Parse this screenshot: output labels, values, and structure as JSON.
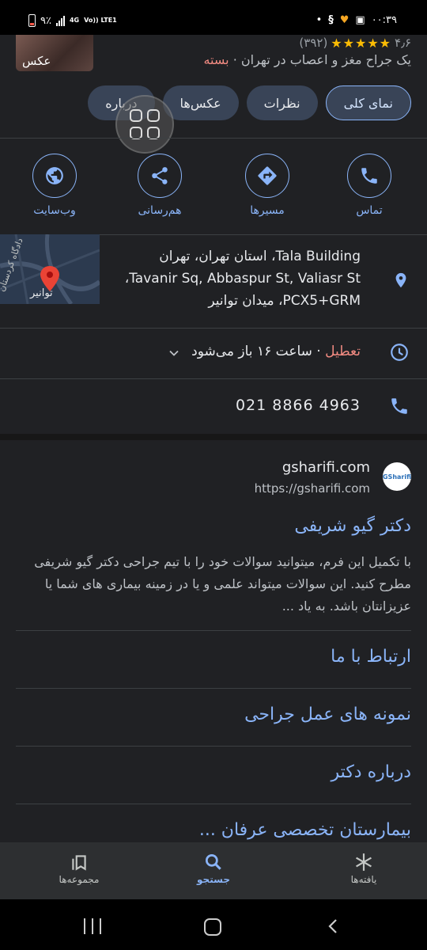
{
  "status_bar": {
    "time": "۰۰:۳۹",
    "battery": "۹٪",
    "network": "4G",
    "volte": "Vo)) LTE1",
    "dot": "•"
  },
  "header": {
    "photo_label": "عکس",
    "rating": "۴٫۶",
    "stars": "★★★★★",
    "review_count": "(۳۹۲)",
    "closed": "بسته",
    "description": "یک جراح مغز و اعصاب در تهران ·"
  },
  "tabs": [
    {
      "label": "نمای کلی"
    },
    {
      "label": "نظرات"
    },
    {
      "label": "عکس‌ها"
    },
    {
      "label": "درباره"
    }
  ],
  "actions": [
    {
      "label": "تماس",
      "icon": "phone-icon"
    },
    {
      "label": "مسیرها",
      "icon": "directions-icon"
    },
    {
      "label": "هم‌رسانی",
      "icon": "share-icon"
    },
    {
      "label": "وب‌سایت",
      "icon": "globe-icon"
    }
  ],
  "map": {
    "label_street": "توانیر",
    "label_side": "دادگاه کردستان"
  },
  "address": {
    "line1": "Tala Building، استان تهران، تهران",
    "line2": "Tavanir Sq, Abbaspur St, Valiasr St،",
    "line3": "PCX5+GRM، میدان توانیر"
  },
  "hours": {
    "status": "تعطیل",
    "detail": " · ساعت ۱۶ باز می‌شود"
  },
  "phone": {
    "number": "021 8866 4963"
  },
  "website": {
    "favicon_text": "GSharifi",
    "name": "gsharifi.com",
    "url": "https://gsharifi.com",
    "title": "دکتر گیو شریفی",
    "description": "با تکمیل این فرم، میتوانید سوالات خود را با تیم جراحی دکتر گیو شریفی مطرح کنید. این سوالات میتواند علمی و یا در زمینه بیماری های شما یا عزیزانتان باشد. به یاد ...",
    "links": [
      {
        "label": "ارتباط با ما"
      },
      {
        "label": "نمونه های عمل جراحی"
      },
      {
        "label": "درباره دکتر"
      },
      {
        "label": "بیمارستان تخصصی عرفان ..."
      }
    ]
  },
  "bottom_nav": [
    {
      "label": "یافته‌ها",
      "icon": "asterisk-icon"
    },
    {
      "label": "جستجو",
      "icon": "search-icon"
    },
    {
      "label": "مجموعه‌ها",
      "icon": "collections-icon"
    }
  ],
  "colors": {
    "accent": "#8ab4f8",
    "closed": "#f28b82",
    "star": "#fbbc04",
    "background": "#202124"
  }
}
